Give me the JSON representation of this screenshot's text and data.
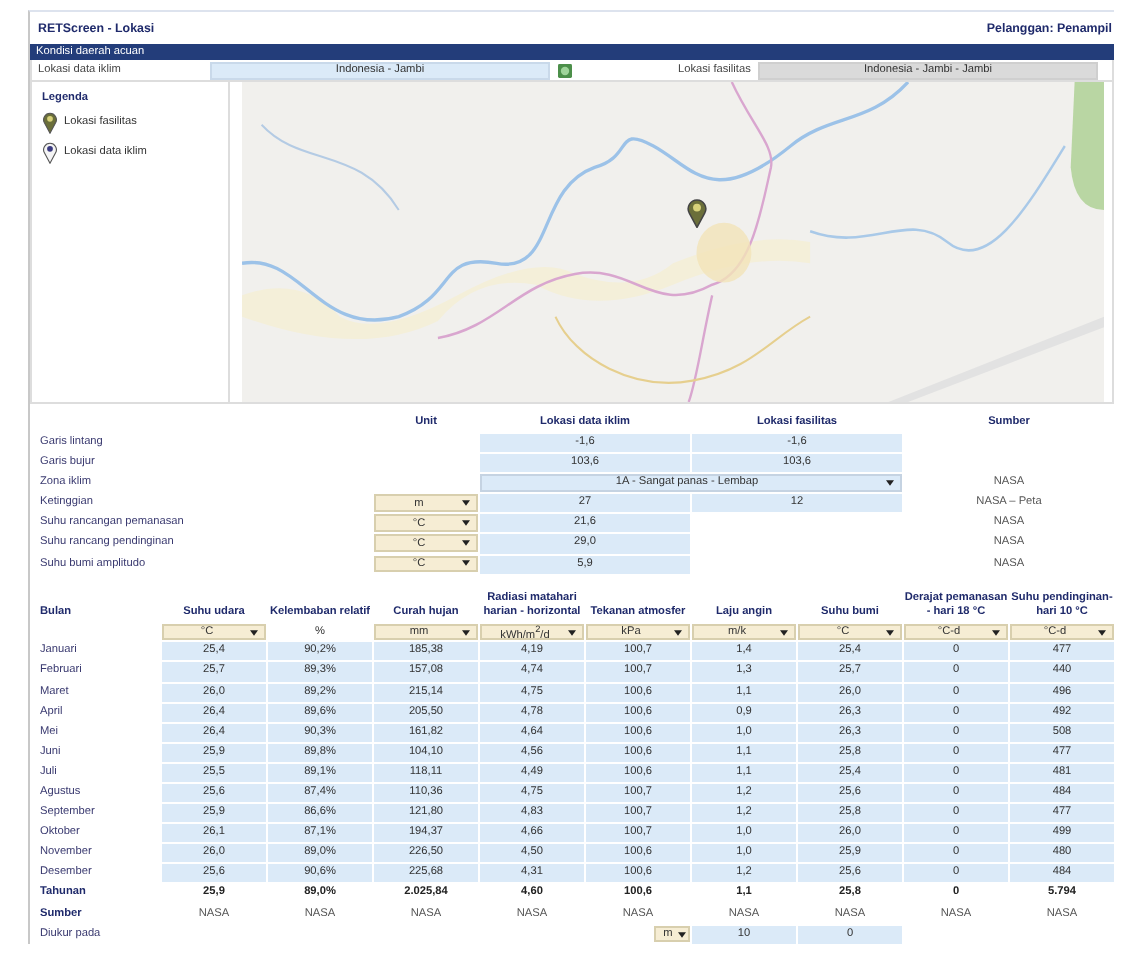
{
  "header": {
    "title": "RETScreen - Lokasi",
    "customer": "Pelanggan: Penampil"
  },
  "section": {
    "title": "Kondisi daerah acuan"
  },
  "climate_location": {
    "label": "Lokasi data iklim",
    "value": "Indonesia - Jambi"
  },
  "facility_location": {
    "label": "Lokasi fasilitas",
    "value": "Indonesia - Jambi - Jambi"
  },
  "legend": {
    "title": "Legenda",
    "items": [
      {
        "label": "Lokasi fasilitas",
        "kind": "facility"
      },
      {
        "label": "Lokasi data iklim",
        "kind": "climate"
      }
    ]
  },
  "params": {
    "columns": [
      "Unit",
      "Lokasi data iklim",
      "Lokasi fasilitas",
      "Sumber"
    ],
    "rows": [
      {
        "kind": "pair",
        "label": "Garis lintang",
        "climate": "-1,6",
        "facility": "-1,6"
      },
      {
        "kind": "pair",
        "label": "Garis bujur",
        "climate": "103,6",
        "facility": "103,6"
      },
      {
        "kind": "select",
        "label": "Zona iklim",
        "climate": "1A - Sangat panas - Lembap",
        "source": "NASA"
      },
      {
        "kind": "pair",
        "label": "Ketinggian",
        "unit": "m",
        "climate": "27",
        "facility": "12",
        "source": "NASA – Peta"
      },
      {
        "kind": "single",
        "label": "Suhu rancangan pemanasan",
        "unit": "°C",
        "climate": "21,6",
        "source": "NASA"
      },
      {
        "kind": "single",
        "label": "Suhu rancang pendinginan",
        "unit": "°C",
        "climate": "29,0",
        "source": "NASA"
      },
      {
        "kind": "single",
        "label": "Suhu bumi amplitudo",
        "unit": "°C",
        "climate": "5,9",
        "source": "NASA"
      }
    ]
  },
  "monthly": {
    "month_header": "Bulan",
    "columns": [
      {
        "title": "Suhu udara",
        "unit": "°C",
        "kind": "select"
      },
      {
        "title": "Kelembaban relatif",
        "unit": "%",
        "kind": "fixed"
      },
      {
        "title": "Curah hujan",
        "unit": "mm",
        "kind": "select"
      },
      {
        "title": "Radiasi matahari harian - horizontal",
        "unit": "kWh/m$^{2}$/d",
        "kind": "select"
      },
      {
        "title": "Tekanan atmosfer",
        "unit": "kPa",
        "kind": "select"
      },
      {
        "title": "Laju angin",
        "unit": "m/k",
        "kind": "select"
      },
      {
        "title": "Suhu bumi",
        "unit": "°C",
        "kind": "select"
      },
      {
        "title": "Derajat pemanasan - hari 18 °C",
        "unit": "°C-d",
        "kind": "select"
      },
      {
        "title": "Suhu pendinginan-hari 10 °C",
        "unit": "°C-d",
        "kind": "select"
      }
    ],
    "rows": [
      {
        "month": "Januari",
        "values": [
          "25,4",
          "90,2%",
          "185,38",
          "4,19",
          "100,7",
          "1,4",
          "25,4",
          "0",
          "477"
        ]
      },
      {
        "month": "Februari",
        "values": [
          "25,7",
          "89,3%",
          "157,08",
          "4,74",
          "100,7",
          "1,3",
          "25,7",
          "0",
          "440"
        ]
      },
      {
        "month": "Maret",
        "values": [
          "26,0",
          "89,2%",
          "215,14",
          "4,75",
          "100,6",
          "1,1",
          "26,0",
          "0",
          "496"
        ]
      },
      {
        "month": "April",
        "values": [
          "26,4",
          "89,6%",
          "205,50",
          "4,78",
          "100,6",
          "0,9",
          "26,3",
          "0",
          "492"
        ]
      },
      {
        "month": "Mei",
        "values": [
          "26,4",
          "90,3%",
          "161,82",
          "4,64",
          "100,6",
          "1,0",
          "26,3",
          "0",
          "508"
        ]
      },
      {
        "month": "Juni",
        "values": [
          "25,9",
          "89,8%",
          "104,10",
          "4,56",
          "100,6",
          "1,1",
          "25,8",
          "0",
          "477"
        ]
      },
      {
        "month": "Juli",
        "values": [
          "25,5",
          "89,1%",
          "118,11",
          "4,49",
          "100,6",
          "1,1",
          "25,4",
          "0",
          "481"
        ]
      },
      {
        "month": "Agustus",
        "values": [
          "25,6",
          "87,4%",
          "110,36",
          "4,75",
          "100,7",
          "1,2",
          "25,6",
          "0",
          "484"
        ]
      },
      {
        "month": "September",
        "values": [
          "25,9",
          "86,6%",
          "121,80",
          "4,83",
          "100,7",
          "1,2",
          "25,8",
          "0",
          "477"
        ]
      },
      {
        "month": "Oktober",
        "values": [
          "26,1",
          "87,1%",
          "194,37",
          "4,66",
          "100,7",
          "1,0",
          "26,0",
          "0",
          "499"
        ]
      },
      {
        "month": "November",
        "values": [
          "26,0",
          "89,0%",
          "226,50",
          "4,50",
          "100,6",
          "1,0",
          "25,9",
          "0",
          "480"
        ]
      },
      {
        "month": "Desember",
        "values": [
          "25,6",
          "90,6%",
          "225,68",
          "4,31",
          "100,6",
          "1,2",
          "25,6",
          "0",
          "484"
        ]
      }
    ],
    "totals": {
      "label": "Tahunan",
      "values": [
        "25,9",
        "89,0%",
        "2.025,84",
        "4,60",
        "100,6",
        "1,1",
        "25,8",
        "0",
        "5.794"
      ]
    },
    "sources": {
      "label": "Sumber",
      "values": [
        "NASA",
        "NASA",
        "NASA",
        "NASA",
        "NASA",
        "NASA",
        "NASA",
        "NASA",
        "NASA"
      ]
    },
    "measured": {
      "label": "Diukur pada",
      "unit": "m",
      "values": [
        "10",
        "0"
      ]
    }
  }
}
